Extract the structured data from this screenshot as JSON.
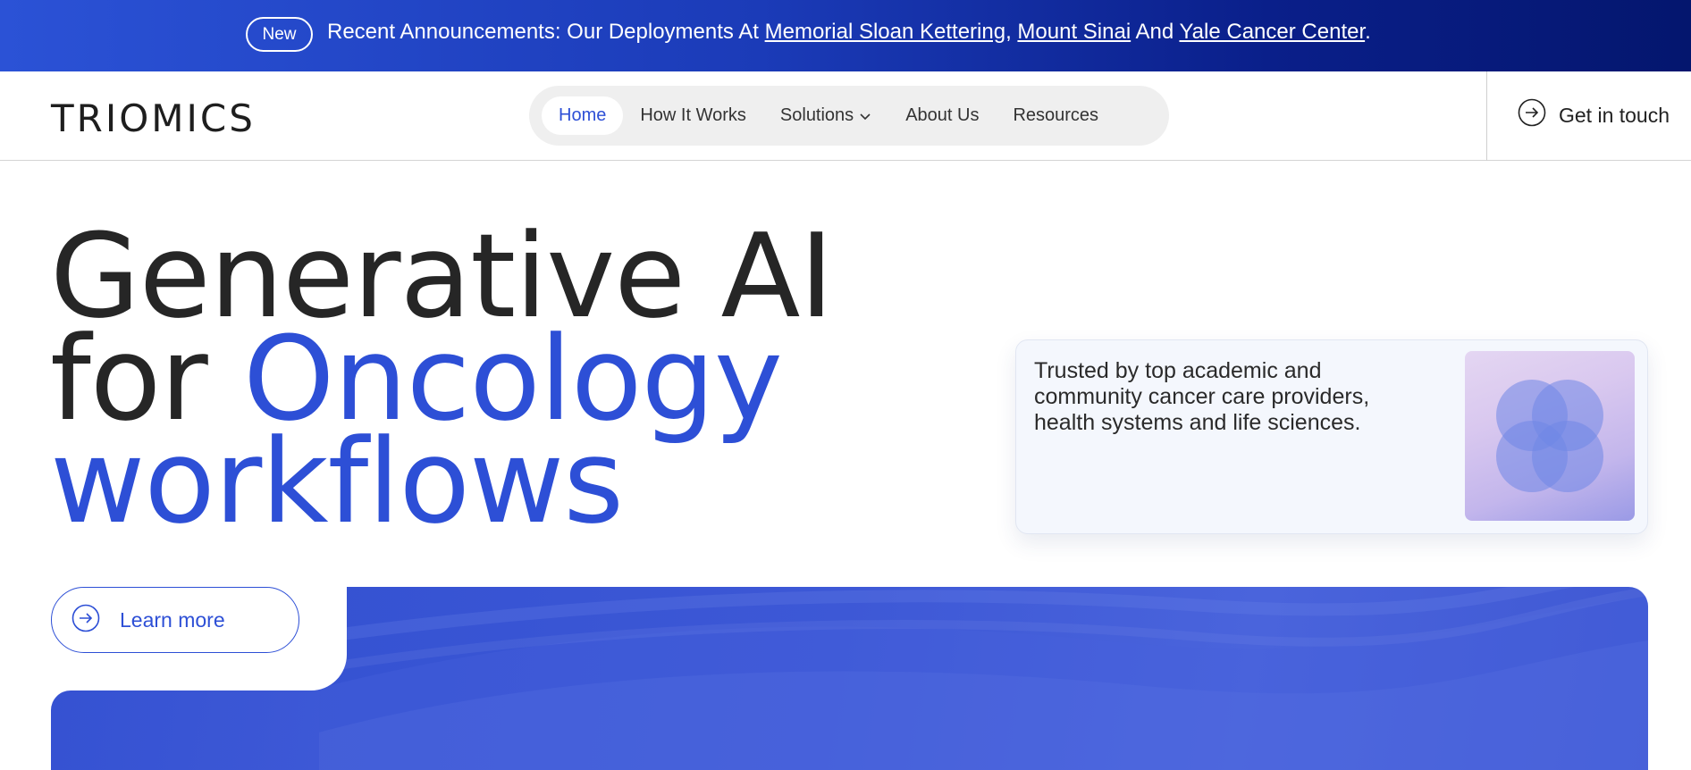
{
  "announcement": {
    "badge": "New",
    "prefix": "Recent Announcements: Our Deployments At ",
    "link1": "Memorial Sloan Kettering",
    "sep1": ", ",
    "link2": "Mount Sinai",
    "sep2": " And ",
    "link3": "Yale Cancer Center",
    "suffix": "."
  },
  "header": {
    "logo": "TRIOMICS",
    "nav": [
      {
        "label": "Home",
        "active": true
      },
      {
        "label": "How It Works"
      },
      {
        "label": "Solutions"
      },
      {
        "label": "About Us"
      },
      {
        "label": "Resources"
      }
    ],
    "cta": "Get in touch"
  },
  "hero": {
    "line1": "Generative AI",
    "line2_prefix": "for ",
    "line2_blue": "Oncology",
    "line3": "workflows",
    "learn_more": "Learn more"
  },
  "trust": {
    "text": "Trusted by top academic and community cancer care providers, health systems and life sciences."
  },
  "colors": {
    "brand_blue": "#2d4fd6",
    "announce_start": "#2b52d6",
    "announce_end": "#04166e"
  },
  "icons": {
    "cta_icon": "arrow-right-circle-icon",
    "learn_icon": "arrow-right-circle-icon",
    "solutions_chevron": "chevron-down-icon",
    "trust_art": "overlapping-circles-icon"
  }
}
